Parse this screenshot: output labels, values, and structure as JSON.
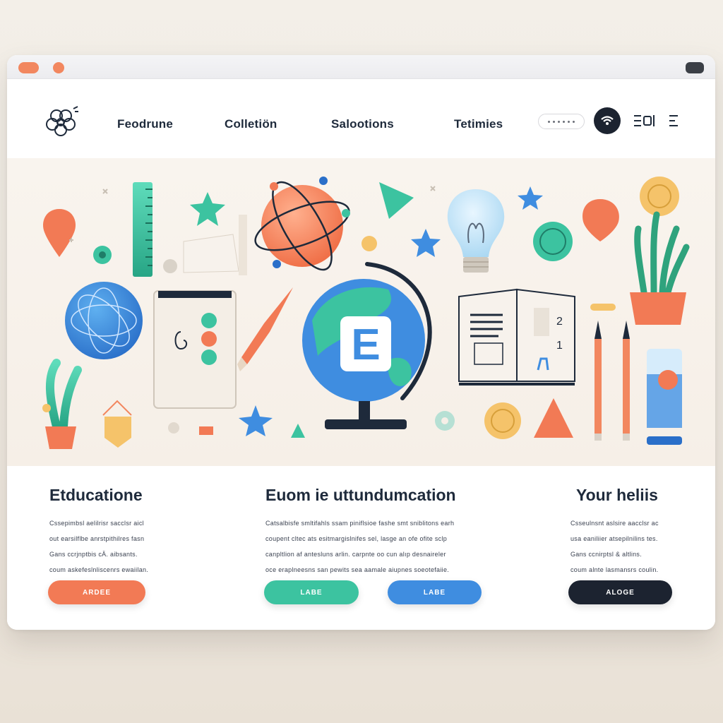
{
  "nav": {
    "links": [
      "Feodrune",
      "Colletiön",
      "Salootions",
      "Tetimies"
    ]
  },
  "hero": {
    "globe_letter": "E",
    "book_numbers": [
      "2",
      "1"
    ]
  },
  "columns": [
    {
      "title": "Etducatione",
      "text": "Cssepimbsl aelilrisr sacclsr aicl\nout earsilflbe anrstpithilres fasn\nGans ccrjnptbis cÄ. aibsants.\ncoum askefeslnliscenrs ewaiilan.",
      "buttons": [
        "ARDEE"
      ]
    },
    {
      "title": "Euom ie uttundumcation",
      "text": "Catsalbisfe smltifahls ssam piniflsioe fashe smt sniblitons earh\ncoupent cltec ats esitmargislnifes sel, lasge an ofe ofite sclp\ncanpltlion af antesluns arlin. carpnte oo cun alıp desnaireler\noce eraplneesns san pewits sea aamale aiupnes soeotefaiie.",
      "buttons": [
        "LABE",
        "LABE"
      ]
    },
    {
      "title": "Your heliis",
      "text": "Csseulnsnt aslsire aacclsr ac\nusa eaniliier atsepilnilins tes.\nGans ccnirptsl & altlins.\ncoum alnte lasmansrs coulin.",
      "buttons": [
        "ALOGE"
      ]
    }
  ],
  "colors": {
    "orange": "#f27a55",
    "teal": "#3cc3a0",
    "blue": "#3f8de0",
    "navy": "#1c2330"
  },
  "icons": [
    "logo-icon",
    "search-icon",
    "wifi-icon",
    "menu-icon",
    "globe-icon",
    "lightbulb-icon",
    "book-icon",
    "pencil-icon",
    "plant-icon",
    "atom-icon",
    "star-icon"
  ]
}
